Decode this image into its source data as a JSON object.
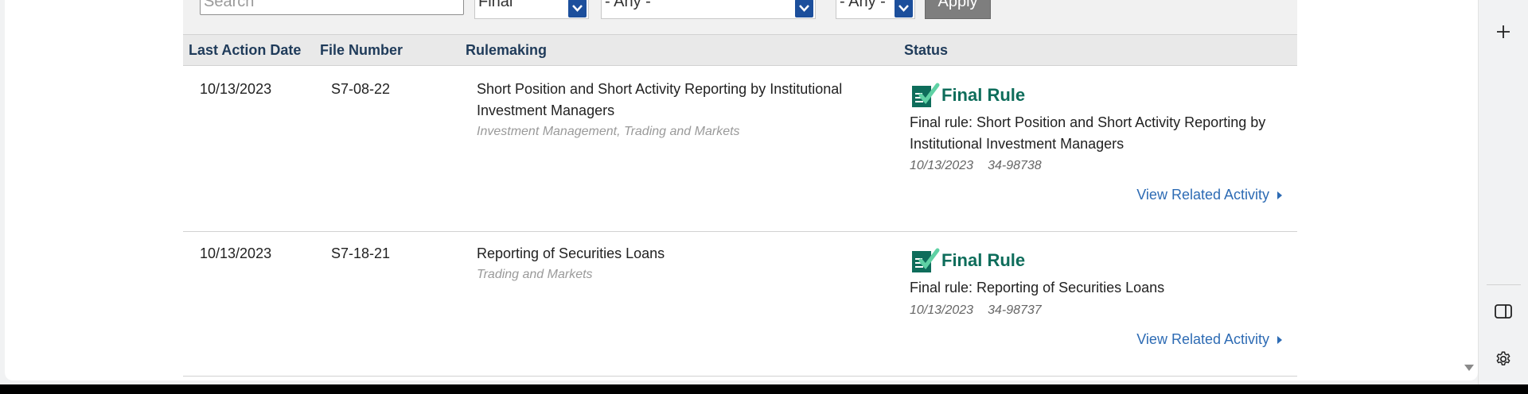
{
  "filters": {
    "search_placeholder": "Search",
    "type_value": "Final",
    "division_value": "- Any -",
    "year_value": "- Any -",
    "apply_label": "Apply"
  },
  "table": {
    "headers": [
      "Last Action Date",
      "File Number",
      "Rulemaking",
      "Status"
    ],
    "rows": [
      {
        "date": "10/13/2023",
        "file_number": "S7-08-22",
        "title": "Short Position and Short Activity Reporting by Institutional Investment Managers",
        "topics": "Investment Management, Trading and Markets",
        "status_label": "Final Rule",
        "status_desc": "Final rule: Short Position and Short Activity Reporting by Institutional Investment Managers",
        "status_date": "10/13/2023",
        "release_number": "34-98738",
        "related_label": "View Related Activity"
      },
      {
        "date": "10/13/2023",
        "file_number": "S7-18-21",
        "title": "Reporting of Securities Loans",
        "topics": "Trading and Markets",
        "status_label": "Final Rule",
        "status_desc": "Final rule: Reporting of Securities Loans",
        "status_date": "10/13/2023",
        "release_number": "34-98737",
        "related_label": "View Related Activity"
      }
    ]
  },
  "sidebar": {
    "icons": [
      "plus-icon",
      "split-view-icon",
      "gear-icon"
    ]
  },
  "colors": {
    "status_green": "#0e6d5b",
    "link_blue": "#2d6bb4",
    "select_arrow": "#1c4f9c"
  }
}
